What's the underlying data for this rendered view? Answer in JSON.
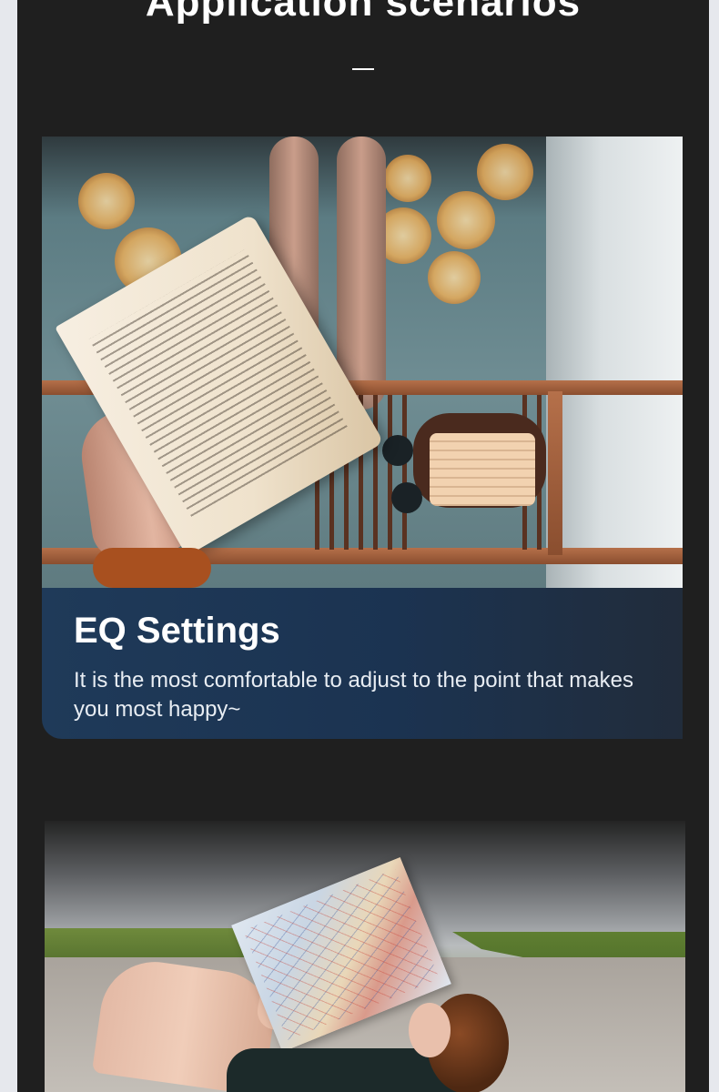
{
  "section": {
    "heading": "Application scenarios"
  },
  "cards": [
    {
      "title": "EQ Settings",
      "description": "It is the most comfortable to adjust to the point that makes you most happy~"
    }
  ]
}
